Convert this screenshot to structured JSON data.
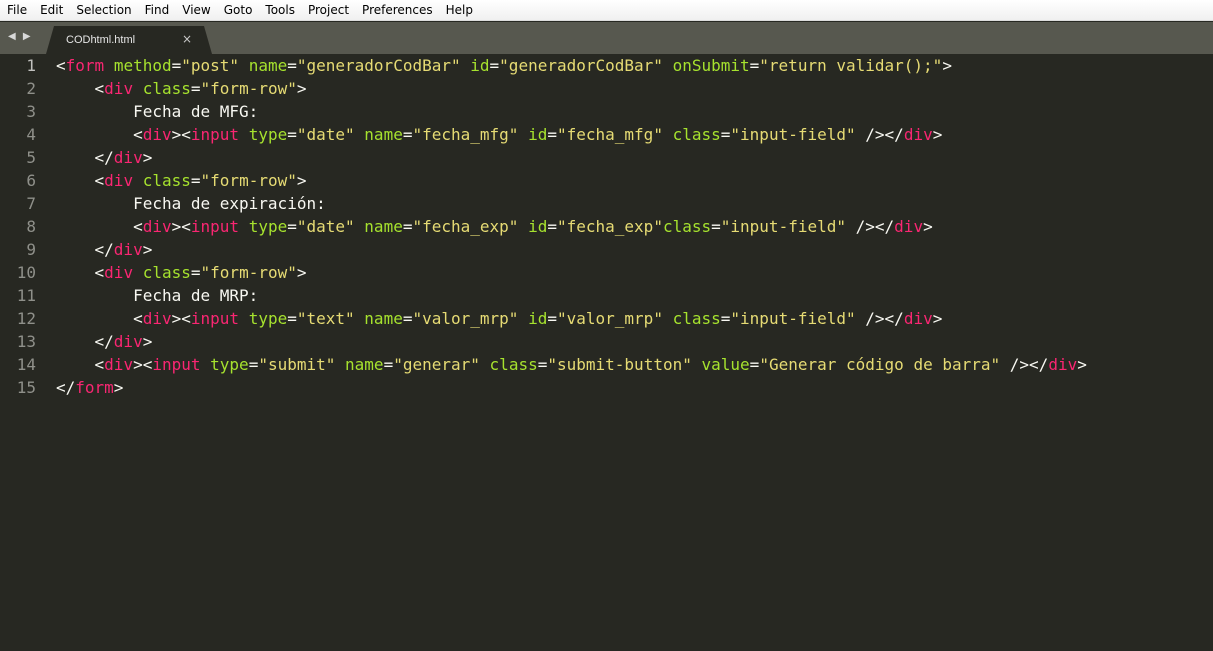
{
  "menu": [
    "File",
    "Edit",
    "Selection",
    "Find",
    "View",
    "Goto",
    "Tools",
    "Project",
    "Preferences",
    "Help"
  ],
  "nav_arrows": "◀ ▶",
  "tab": {
    "title": "CODhtml.html",
    "close": "×"
  },
  "colors": {
    "background": "#272822",
    "tag": "#f92672",
    "attribute": "#a6e22e",
    "string": "#e6db74",
    "text": "#f8f8f2"
  },
  "current_line": 1,
  "code_lines": [
    [
      [
        "p",
        "<"
      ],
      [
        "t",
        "form"
      ],
      [
        "p",
        " "
      ],
      [
        "a",
        "method"
      ],
      [
        "p",
        "="
      ],
      [
        "s",
        "\"post\""
      ],
      [
        "p",
        " "
      ],
      [
        "a",
        "name"
      ],
      [
        "p",
        "="
      ],
      [
        "s",
        "\"generadorCodBar\""
      ],
      [
        "p",
        " "
      ],
      [
        "a",
        "id"
      ],
      [
        "p",
        "="
      ],
      [
        "s",
        "\"generadorCodBar\""
      ],
      [
        "p",
        " "
      ],
      [
        "a",
        "onSubmit"
      ],
      [
        "p",
        "="
      ],
      [
        "s",
        "\"return validar();\""
      ],
      [
        "p",
        ">"
      ]
    ],
    [
      [
        "p",
        "    <"
      ],
      [
        "t",
        "div"
      ],
      [
        "p",
        " "
      ],
      [
        "a",
        "class"
      ],
      [
        "p",
        "="
      ],
      [
        "s",
        "\"form-row\""
      ],
      [
        "p",
        ">"
      ]
    ],
    [
      [
        "p",
        "        Fecha de MFG:"
      ]
    ],
    [
      [
        "p",
        "        <"
      ],
      [
        "t",
        "div"
      ],
      [
        "p",
        "><"
      ],
      [
        "t",
        "input"
      ],
      [
        "p",
        " "
      ],
      [
        "a",
        "type"
      ],
      [
        "p",
        "="
      ],
      [
        "s",
        "\"date\""
      ],
      [
        "p",
        " "
      ],
      [
        "a",
        "name"
      ],
      [
        "p",
        "="
      ],
      [
        "s",
        "\"fecha_mfg\""
      ],
      [
        "p",
        " "
      ],
      [
        "a",
        "id"
      ],
      [
        "p",
        "="
      ],
      [
        "s",
        "\"fecha_mfg\""
      ],
      [
        "p",
        " "
      ],
      [
        "a",
        "class"
      ],
      [
        "p",
        "="
      ],
      [
        "s",
        "\"input-field\""
      ],
      [
        "p",
        " /></"
      ],
      [
        "t",
        "div"
      ],
      [
        "p",
        ">"
      ]
    ],
    [
      [
        "p",
        "    </"
      ],
      [
        "t",
        "div"
      ],
      [
        "p",
        ">"
      ]
    ],
    [
      [
        "p",
        "    <"
      ],
      [
        "t",
        "div"
      ],
      [
        "p",
        " "
      ],
      [
        "a",
        "class"
      ],
      [
        "p",
        "="
      ],
      [
        "s",
        "\"form-row\""
      ],
      [
        "p",
        ">"
      ]
    ],
    [
      [
        "p",
        "        Fecha de expiración:"
      ]
    ],
    [
      [
        "p",
        "        <"
      ],
      [
        "t",
        "div"
      ],
      [
        "p",
        "><"
      ],
      [
        "t",
        "input"
      ],
      [
        "p",
        " "
      ],
      [
        "a",
        "type"
      ],
      [
        "p",
        "="
      ],
      [
        "s",
        "\"date\""
      ],
      [
        "p",
        " "
      ],
      [
        "a",
        "name"
      ],
      [
        "p",
        "="
      ],
      [
        "s",
        "\"fecha_exp\""
      ],
      [
        "p",
        " "
      ],
      [
        "a",
        "id"
      ],
      [
        "p",
        "="
      ],
      [
        "s",
        "\"fecha_exp\""
      ],
      [
        "a",
        "class"
      ],
      [
        "p",
        "="
      ],
      [
        "s",
        "\"input-field\""
      ],
      [
        "p",
        " /></"
      ],
      [
        "t",
        "div"
      ],
      [
        "p",
        ">"
      ]
    ],
    [
      [
        "p",
        "    </"
      ],
      [
        "t",
        "div"
      ],
      [
        "p",
        ">"
      ]
    ],
    [
      [
        "p",
        "    <"
      ],
      [
        "t",
        "div"
      ],
      [
        "p",
        " "
      ],
      [
        "a",
        "class"
      ],
      [
        "p",
        "="
      ],
      [
        "s",
        "\"form-row\""
      ],
      [
        "p",
        ">"
      ]
    ],
    [
      [
        "p",
        "        Fecha de MRP:"
      ]
    ],
    [
      [
        "p",
        "        <"
      ],
      [
        "t",
        "div"
      ],
      [
        "p",
        "><"
      ],
      [
        "t",
        "input"
      ],
      [
        "p",
        " "
      ],
      [
        "a",
        "type"
      ],
      [
        "p",
        "="
      ],
      [
        "s",
        "\"text\""
      ],
      [
        "p",
        " "
      ],
      [
        "a",
        "name"
      ],
      [
        "p",
        "="
      ],
      [
        "s",
        "\"valor_mrp\""
      ],
      [
        "p",
        " "
      ],
      [
        "a",
        "id"
      ],
      [
        "p",
        "="
      ],
      [
        "s",
        "\"valor_mrp\""
      ],
      [
        "p",
        " "
      ],
      [
        "a",
        "class"
      ],
      [
        "p",
        "="
      ],
      [
        "s",
        "\"input-field\""
      ],
      [
        "p",
        " /></"
      ],
      [
        "t",
        "div"
      ],
      [
        "p",
        ">"
      ]
    ],
    [
      [
        "p",
        "    </"
      ],
      [
        "t",
        "div"
      ],
      [
        "p",
        ">"
      ]
    ],
    [
      [
        "p",
        "    <"
      ],
      [
        "t",
        "div"
      ],
      [
        "p",
        "><"
      ],
      [
        "t",
        "input"
      ],
      [
        "p",
        " "
      ],
      [
        "a",
        "type"
      ],
      [
        "p",
        "="
      ],
      [
        "s",
        "\"submit\""
      ],
      [
        "p",
        " "
      ],
      [
        "a",
        "name"
      ],
      [
        "p",
        "="
      ],
      [
        "s",
        "\"generar\""
      ],
      [
        "p",
        " "
      ],
      [
        "a",
        "class"
      ],
      [
        "p",
        "="
      ],
      [
        "s",
        "\"submit-button\""
      ],
      [
        "p",
        " "
      ],
      [
        "a",
        "value"
      ],
      [
        "p",
        "="
      ],
      [
        "s",
        "\"Generar código de barra\""
      ],
      [
        "p",
        " /></"
      ],
      [
        "t",
        "div"
      ],
      [
        "p",
        ">"
      ]
    ],
    [
      [
        "p",
        "</"
      ],
      [
        "t",
        "form"
      ],
      [
        "p",
        ">"
      ]
    ]
  ]
}
